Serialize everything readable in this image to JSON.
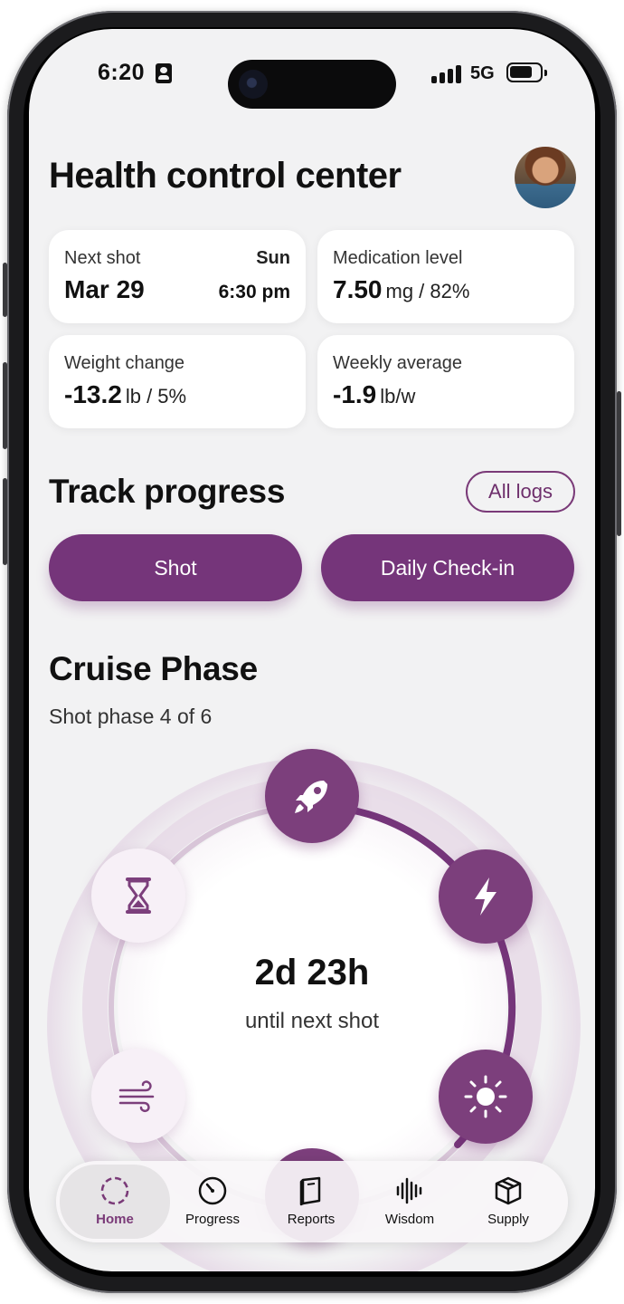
{
  "status_bar": {
    "time": "6:20",
    "network": "5G"
  },
  "header": {
    "title": "Health control center"
  },
  "cards": {
    "next_shot": {
      "label": "Next shot",
      "day": "Sun",
      "date": "Mar 29",
      "time": "6:30 pm"
    },
    "medication_level": {
      "label": "Medication level",
      "value": "7.50",
      "unit": "mg / 82%"
    },
    "weight_change": {
      "label": "Weight change",
      "value": "-13.2",
      "unit": "lb / 5%"
    },
    "weekly_average": {
      "label": "Weekly average",
      "value": "-1.9",
      "unit": "lb/w"
    }
  },
  "track": {
    "title": "Track progress",
    "all_logs": "All logs",
    "shot_button": "Shot",
    "checkin_button": "Daily Check-in"
  },
  "phase": {
    "title": "Cruise Phase",
    "subtitle": "Shot phase 4 of 6",
    "countdown": "2d 23h",
    "countdown_label": "until next shot",
    "icons": [
      "rocket-icon",
      "lightning-icon",
      "sun-icon",
      "hourglass-icon",
      "wind-icon"
    ]
  },
  "nav": {
    "items": [
      {
        "label": "Home",
        "icon": "home-icon",
        "active": true
      },
      {
        "label": "Progress",
        "icon": "progress-icon",
        "active": false
      },
      {
        "label": "Reports",
        "icon": "reports-icon",
        "active": false
      },
      {
        "label": "Wisdom",
        "icon": "wisdom-icon",
        "active": false
      },
      {
        "label": "Supply",
        "icon": "supply-icon",
        "active": false
      }
    ]
  },
  "colors": {
    "accent": "#75357a",
    "background": "#f2f2f3",
    "card": "#ffffff"
  }
}
